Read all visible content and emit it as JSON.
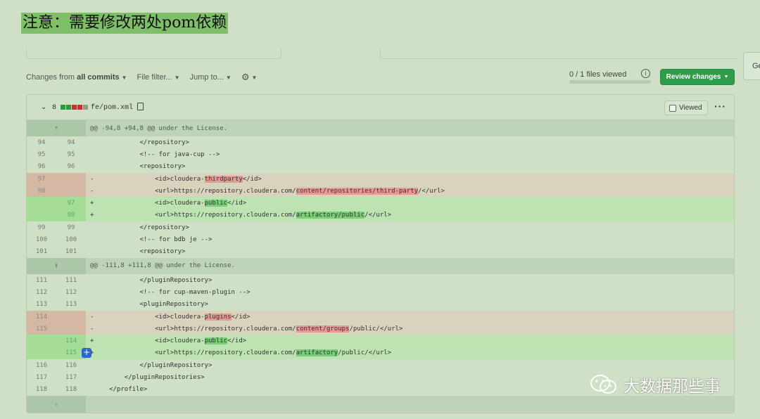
{
  "note": "注意：需要修改两处pom依赖",
  "toolbar": {
    "changes_prefix": "Changes from",
    "changes_value": "all commits",
    "file_filter": "File filter...",
    "jump_to": "Jump to...",
    "files_viewed": "0 / 1 files viewed",
    "files_viewed_fraction": 0,
    "review_changes": "Review changes",
    "side_tab": "Ge"
  },
  "file": {
    "changes_count": "8",
    "name": "fe/pom.xml",
    "viewed_label": "Viewed",
    "more": "···"
  },
  "diff": [
    {
      "type": "hunk",
      "text": "@@ -94,8 +94,8 @@ under the License."
    },
    {
      "type": "ctx",
      "old": "94",
      "new": "94",
      "code": "            </repository>"
    },
    {
      "type": "ctx",
      "old": "95",
      "new": "95",
      "code": "            <!-- for java-cup -->"
    },
    {
      "type": "ctx",
      "old": "96",
      "new": "96",
      "code": "            <repository>"
    },
    {
      "type": "del",
      "old": "97",
      "new": "",
      "sign": "-",
      "pre": "                <id>cloudera-",
      "hl": "thirdparty",
      "post": "</id>"
    },
    {
      "type": "del",
      "old": "98",
      "new": "",
      "sign": "-",
      "pre": "                <url>https://repository.cloudera.com/",
      "hl": "content/repositories/third-party",
      "post": "/</url>"
    },
    {
      "type": "add",
      "old": "",
      "new": "97",
      "sign": "+",
      "pre": "                <id>cloudera-",
      "hl": "public",
      "post": "</id>"
    },
    {
      "type": "add",
      "old": "",
      "new": "98",
      "sign": "+",
      "pre": "                <url>https://repository.cloudera.com/",
      "hl": "artifactory/public",
      "post": "/</url>"
    },
    {
      "type": "ctx",
      "old": "99",
      "new": "99",
      "code": "            </repository>"
    },
    {
      "type": "ctx",
      "old": "100",
      "new": "100",
      "code": "            <!-- for bdb je -->"
    },
    {
      "type": "ctx",
      "old": "101",
      "new": "101",
      "code": "            <repository>"
    },
    {
      "type": "hunk",
      "text": "@@ -111,8 +111,8 @@ under the License."
    },
    {
      "type": "ctx",
      "old": "111",
      "new": "111",
      "code": "            </pluginRepository>"
    },
    {
      "type": "ctx",
      "old": "112",
      "new": "112",
      "code": "            <!-- for cup-maven-plugin -->"
    },
    {
      "type": "ctx",
      "old": "113",
      "new": "113",
      "code": "            <pluginRepository>"
    },
    {
      "type": "del",
      "old": "114",
      "new": "",
      "sign": "-",
      "pre": "                <id>cloudera-",
      "hl": "plugins",
      "post": "</id>"
    },
    {
      "type": "del",
      "old": "115",
      "new": "",
      "sign": "-",
      "pre": "                <url>https://repository.cloudera.com/",
      "hl": "content/groups",
      "post": "/public/</url>"
    },
    {
      "type": "add",
      "old": "",
      "new": "114",
      "sign": "+",
      "pre": "                <id>cloudera-",
      "hl": "public",
      "post": "</id>"
    },
    {
      "type": "add",
      "old": "",
      "new": "115",
      "sign": "+",
      "pre": "                <url>https://repository.cloudera.com/",
      "hl": "artifactory",
      "post": "/public/</url>",
      "comment_button": "+"
    },
    {
      "type": "ctx",
      "old": "116",
      "new": "116",
      "code": "            </pluginRepository>"
    },
    {
      "type": "ctx",
      "old": "117",
      "new": "117",
      "code": "        </pluginRepositories>"
    },
    {
      "type": "ctx",
      "old": "118",
      "new": "118",
      "code": "    </profile>"
    },
    {
      "type": "tail"
    }
  ],
  "watermark": "大数据那些事"
}
